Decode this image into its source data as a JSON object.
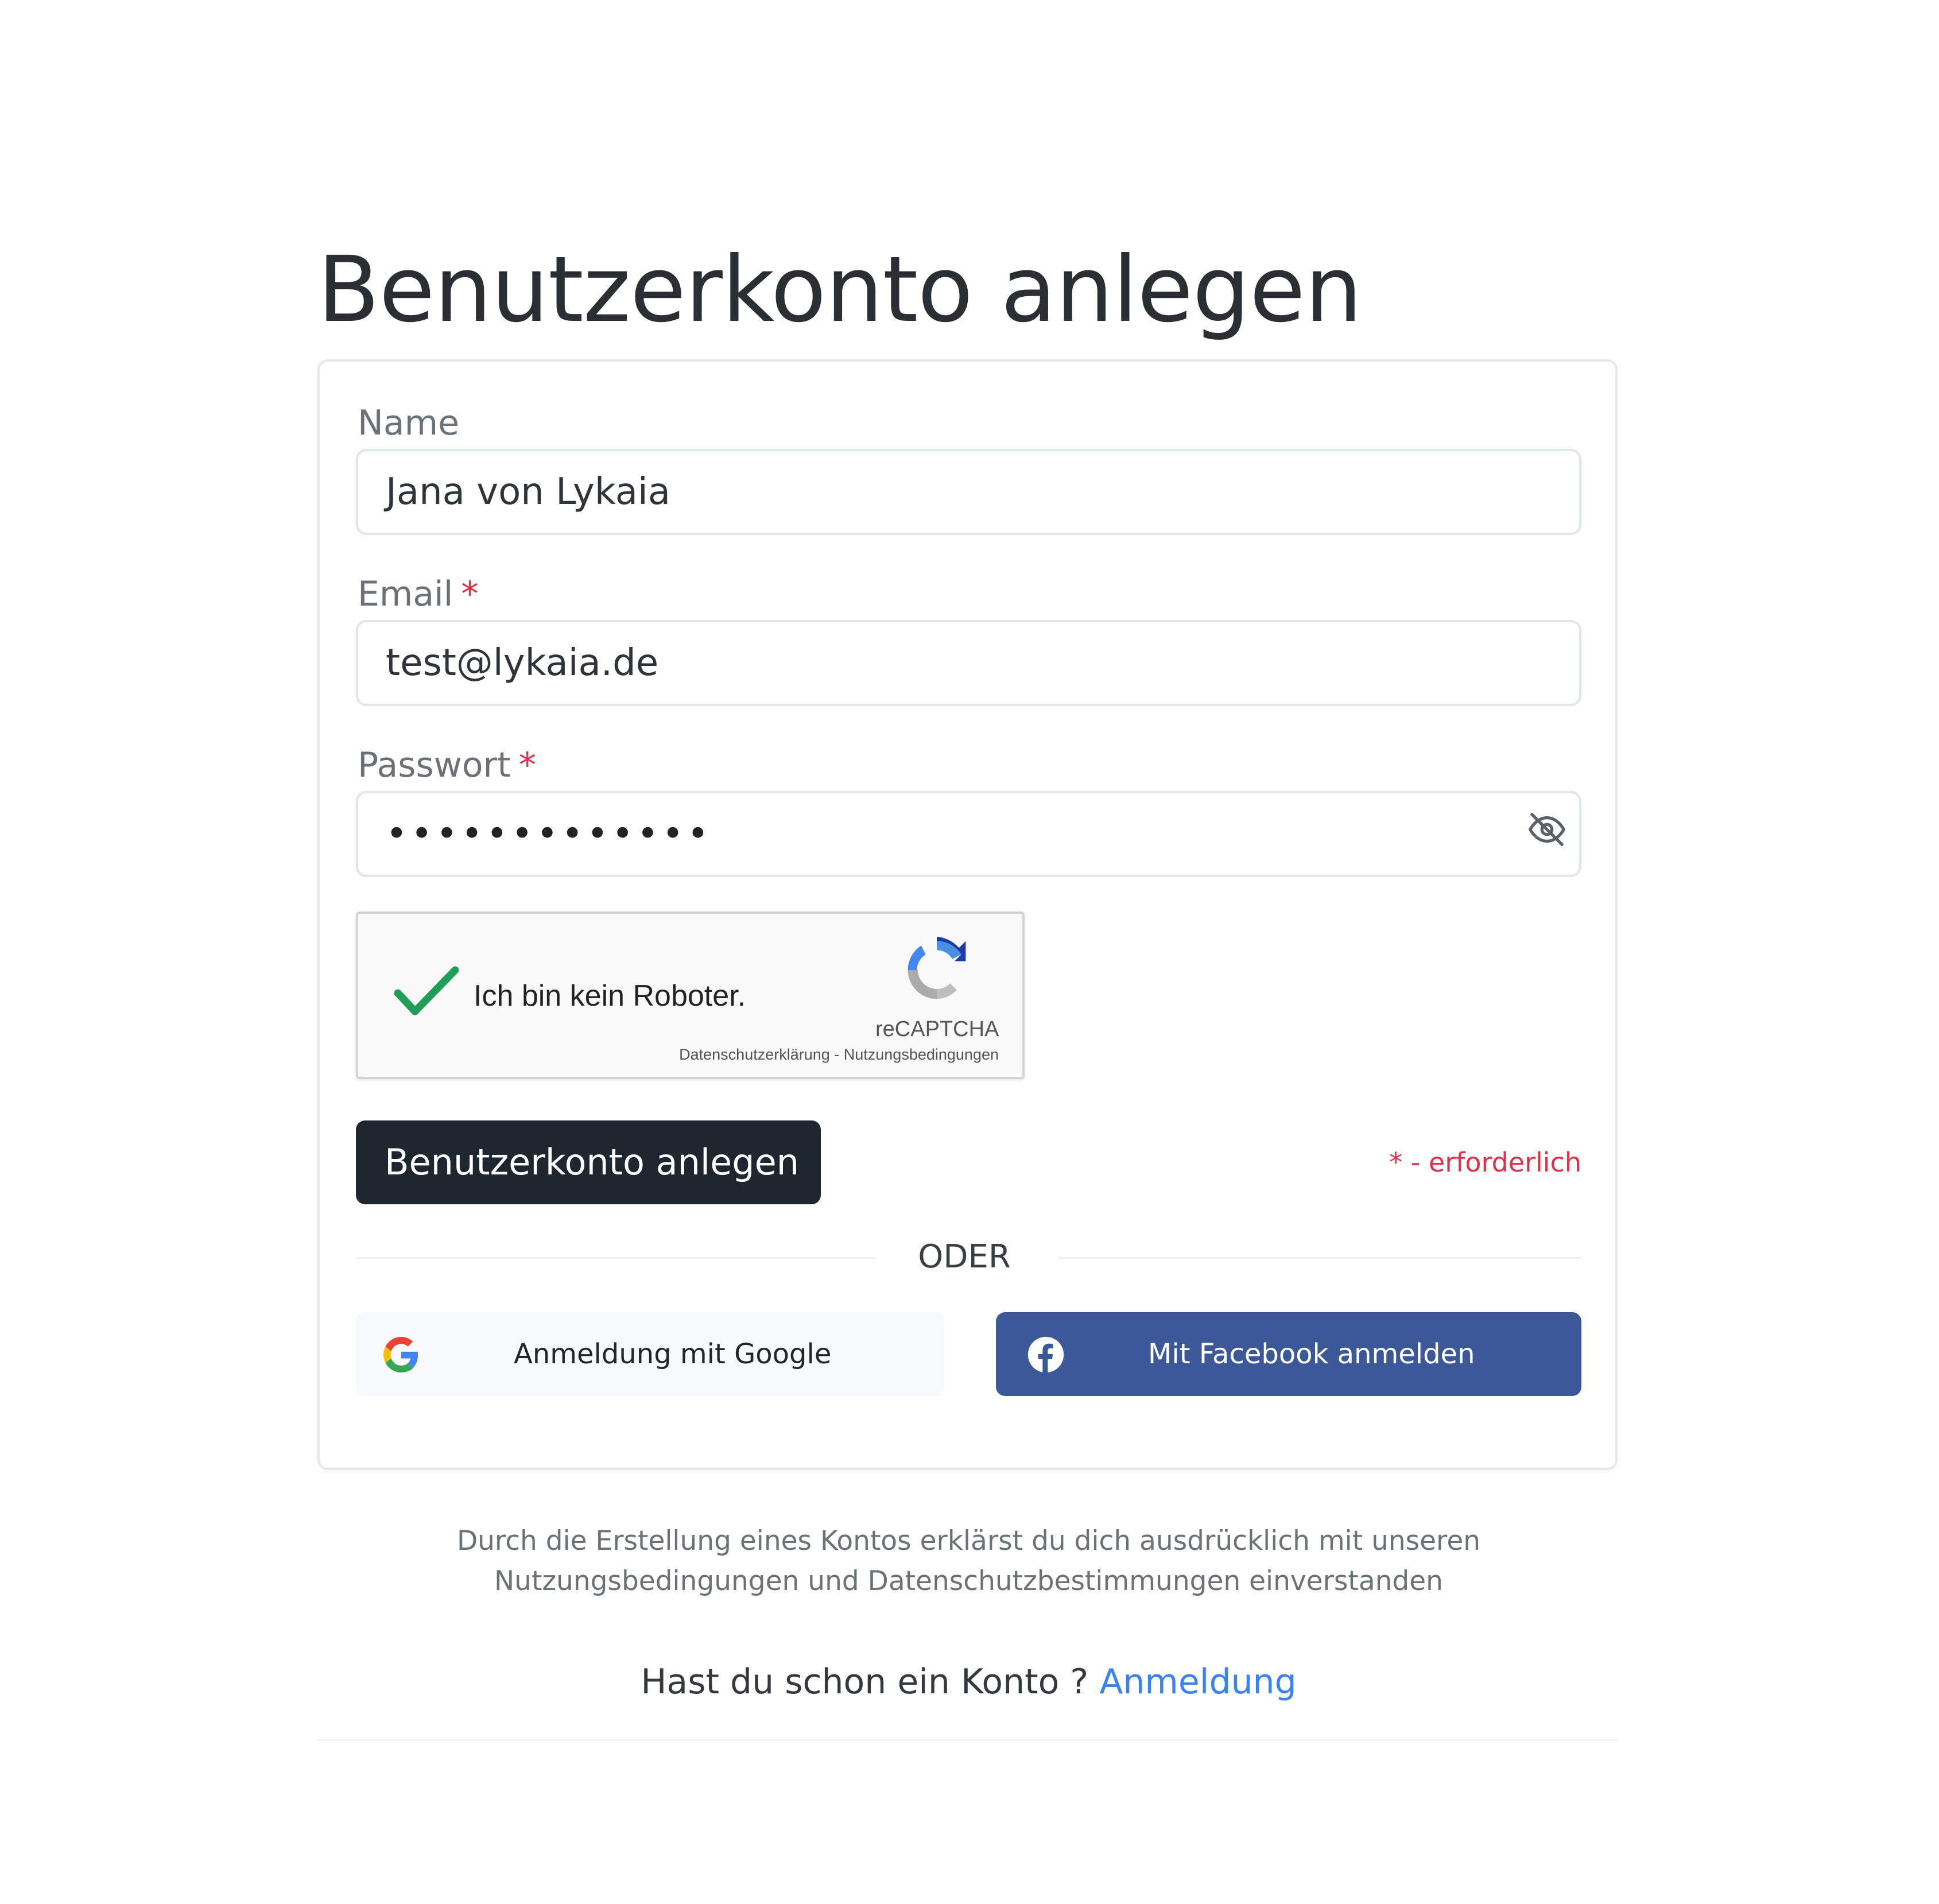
{
  "page": {
    "title": "Benutzerkonto anlegen"
  },
  "form": {
    "name": {
      "label": "Name",
      "value": "Jana von Lykaia"
    },
    "email": {
      "label": "Email",
      "required_marker": "*",
      "value": "test@lykaia.de"
    },
    "password": {
      "label": "Passwort",
      "required_marker": "*",
      "masked_value": "•••••••••••••",
      "toggle_icon": "eye-slash-icon"
    },
    "captcha": {
      "checked": true,
      "label": "Ich bin kein Roboter.",
      "brand": "reCAPTCHA",
      "links": "Datenschutzerklärung - Nutzungsbedingungen"
    },
    "submit_label": "Benutzerkonto anlegen",
    "required_note": "* - erforderlich",
    "divider_text": "ODER",
    "google_label": "Anmeldung mit Google",
    "facebook_label": "Mit Facebook anmelden"
  },
  "footer": {
    "terms_line1": "Durch die Erstellung eines Kontos erklärst du dich ausdrücklich mit unseren",
    "terms_line2": "Nutzungsbedingungen und Datenschutzbestimmungen einverstanden",
    "login_prompt": "Hast du schon ein Konto ?",
    "login_link": "Anmeldung"
  },
  "colors": {
    "primary_button": "#1e262f",
    "facebook": "#3b5998",
    "required": "#e2304a",
    "link": "#3b82f6",
    "captcha_check": "#1e9e57"
  }
}
